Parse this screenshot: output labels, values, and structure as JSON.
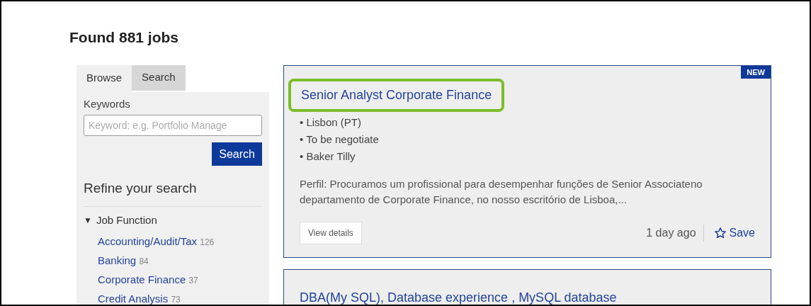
{
  "heading": "Found 881 jobs",
  "tabs": [
    {
      "label": "Browse",
      "selected": true
    },
    {
      "label": "Search",
      "selected": false
    }
  ],
  "keywords": {
    "label": "Keywords",
    "placeholder": "Keyword: e.g. Portfolio Manage",
    "button": "Search"
  },
  "refine": {
    "title": "Refine your search",
    "group": {
      "label": "Job Function",
      "toggle": "▼",
      "expanded": true,
      "items": [
        {
          "name": "Accounting/Audit/Tax",
          "count": "126"
        },
        {
          "name": "Banking",
          "count": "84"
        },
        {
          "name": "Corporate Finance",
          "count": "37"
        },
        {
          "name": "Credit Analysis",
          "count": "73"
        }
      ]
    }
  },
  "jobs": [
    {
      "title": "Senior Analyst Corporate Finance",
      "badge": "NEW",
      "highlighted": true,
      "details": [
        "• Lisbon (PT)",
        "• To be negotiate",
        "• Baker Tilly"
      ],
      "summary": "Perfil: Procuramos um profissional para desempenhar funções de Senior Associateno departamento de Corporate Finance, no nosso escritório de Lisboa,...",
      "view_button": "View details",
      "posted": "1 day ago",
      "save": "Save"
    },
    {
      "title": "DBA(My SQL), Database experience , MySQL database",
      "highlighted": false
    }
  ]
}
